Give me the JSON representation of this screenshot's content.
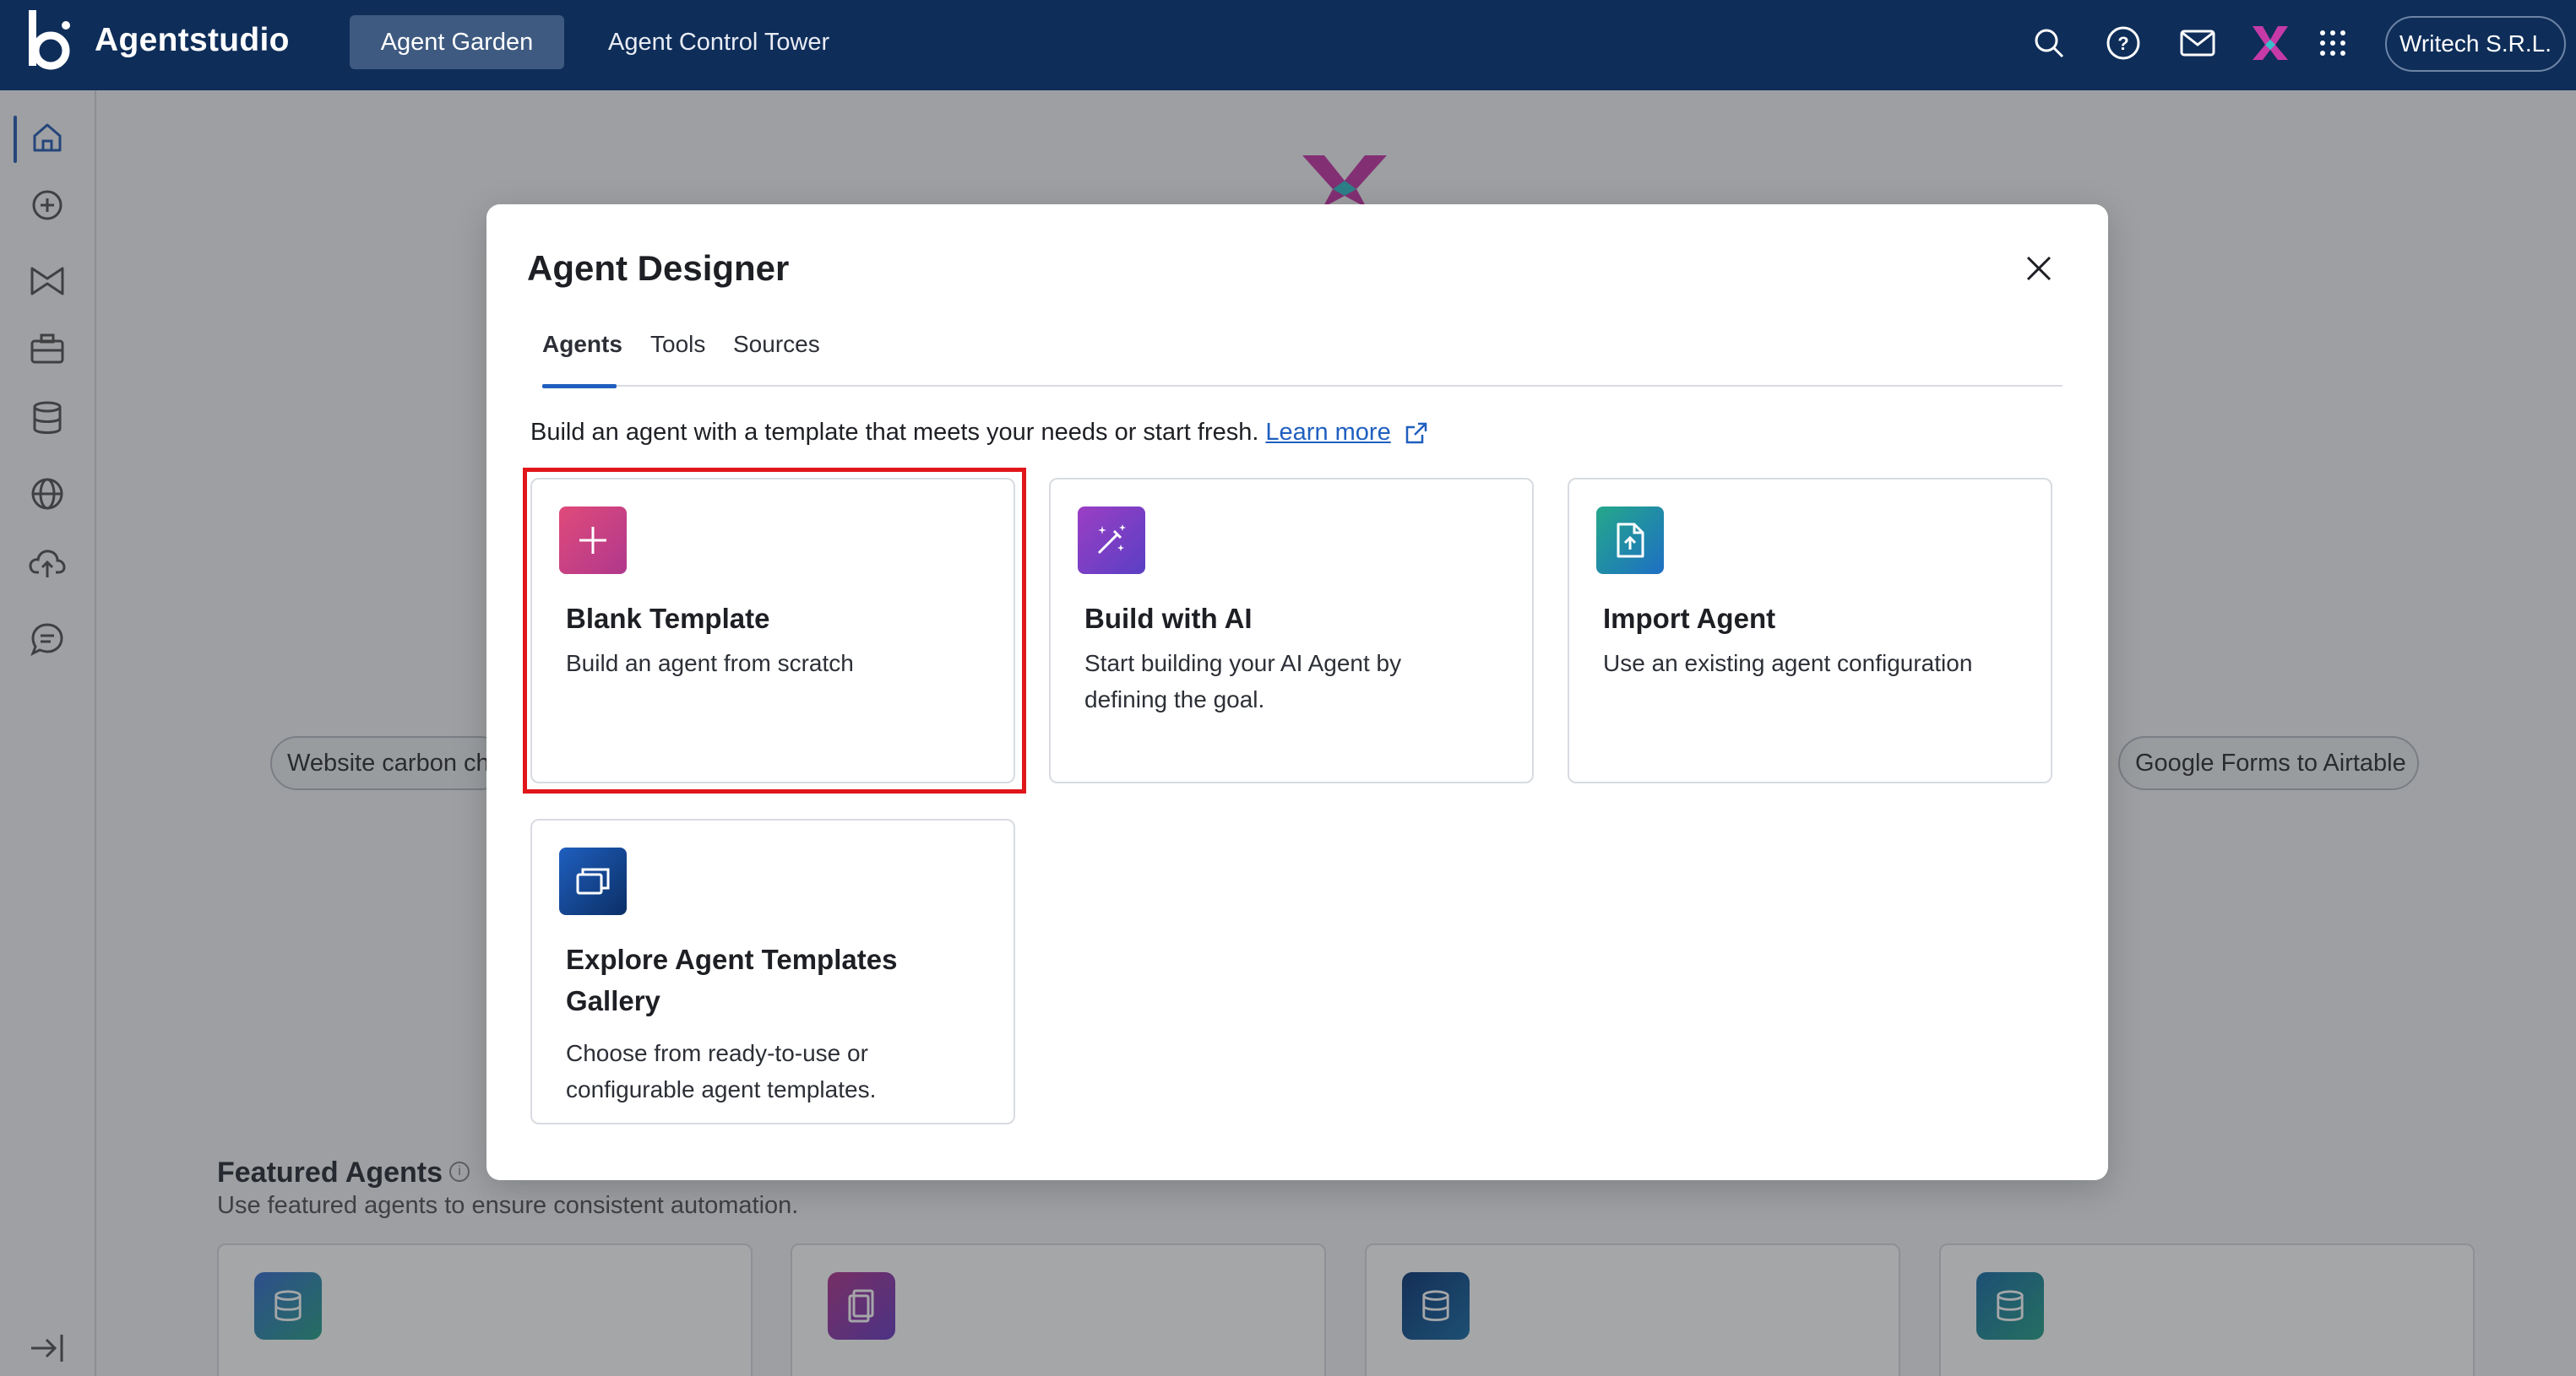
{
  "topbar": {
    "brand": "Agentstudio",
    "tabs": [
      {
        "label": "Agent Garden",
        "active": true
      },
      {
        "label": "Agent Control Tower",
        "active": false
      }
    ],
    "icons": [
      "search-icon",
      "help-icon",
      "mail-icon",
      "app-logo-icon",
      "apps-grid-icon"
    ],
    "org": "Writech S.R.L."
  },
  "sidebar": {
    "items": [
      "home-icon",
      "add-icon",
      "bowtie-icon",
      "briefcase-icon",
      "database-icon",
      "globe-icon",
      "cloud-upload-icon",
      "chat-icon"
    ],
    "collapse_icon": "expand-sidebar-icon"
  },
  "background": {
    "chips": [
      "Website carbon ch",
      "Google Forms to Airtable"
    ],
    "featured_title": "Featured Agents",
    "featured_sub": "Use featured agents to ensure consistent automation."
  },
  "modal": {
    "title": "Agent Designer",
    "tabs": [
      "Agents",
      "Tools",
      "Sources"
    ],
    "active_tab": "Agents",
    "intro": "Build an agent with a template that meets your needs or start fresh.",
    "learn_more": "Learn more",
    "cards": [
      {
        "title": "Blank Template",
        "desc": "Build an agent from scratch",
        "icon": "plus-icon",
        "color": "#c0407a"
      },
      {
        "title": "Build with AI",
        "desc": "Start building your AI Agent by defining the goal.",
        "icon": "magic-wand-icon",
        "color": "#7a3fc4"
      },
      {
        "title": "Import Agent",
        "desc": "Use an existing agent configuration",
        "icon": "file-import-icon",
        "color": "#1e8fa8"
      },
      {
        "title": "Explore Agent Templates Gallery",
        "desc": "Choose from ready-to-use or configurable agent templates.",
        "icon": "gallery-icon",
        "color": "#0f3a78"
      }
    ]
  },
  "colors": {
    "topbar": "#0e2d59",
    "accent": "#1f5fbf",
    "highlight": "#e0161b"
  }
}
